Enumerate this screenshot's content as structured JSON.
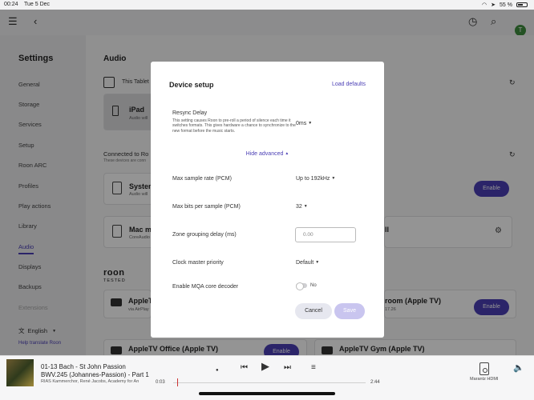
{
  "status": {
    "time": "00:24",
    "date": "Tue 5 Dec",
    "battery": "55 %"
  },
  "sidebar": {
    "title": "Settings",
    "items": [
      {
        "label": "General"
      },
      {
        "label": "Storage"
      },
      {
        "label": "Services"
      },
      {
        "label": "Setup"
      },
      {
        "label": "Roon ARC"
      },
      {
        "label": "Profiles"
      },
      {
        "label": "Play actions"
      },
      {
        "label": "Library"
      },
      {
        "label": "Audio"
      },
      {
        "label": "Displays"
      },
      {
        "label": "Backups"
      },
      {
        "label": "Extensions"
      }
    ],
    "language": "English",
    "help": "Help translate Roon"
  },
  "main": {
    "heading": "Audio",
    "this_tablet": "This Tablet",
    "ipad_name": "iPad",
    "ipad_sub": "Audio will",
    "connected": "Connected to Ro",
    "connected_sub": "These devices are conn",
    "system_name": "System",
    "system_sub": "Audio will",
    "mac_name": "Mac m",
    "mac_sub": "CoreAudio",
    "roon_tested_1": "roon",
    "roon_tested_2": "TESTED",
    "apple1_name": "AppleT",
    "apple1_sub": "via AirPlay",
    "room_name": "room (Apple TV)",
    "room_sub": "17.26",
    "office_name": "AppleTV Office (Apple TV)",
    "gym_name": "AppleTV Gym (Apple TV)",
    "enable": "Enable",
    "mac_right": "ll"
  },
  "modal": {
    "title": "Device setup",
    "load_defaults": "Load defaults",
    "resync_label": "Resync Delay",
    "resync_desc": "This setting causes Roon to pre-roll a period of silence each time it switches formats. This gives hardware a chance to synchronize to the new format before the music starts.",
    "resync_value": "0ms",
    "hide_advanced": "Hide advanced",
    "max_rate_label": "Max sample rate (PCM)",
    "max_rate_value": "Up to 192kHz",
    "max_bits_label": "Max bits per sample (PCM)",
    "max_bits_value": "32",
    "zone_delay_label": "Zone grouping delay (ms)",
    "zone_delay_placeholder": "0.00",
    "clock_label": "Clock master priority",
    "clock_value": "Default",
    "mqa_label": "Enable MQA core decoder",
    "mqa_value": "No",
    "cancel": "Cancel",
    "save": "Save"
  },
  "player": {
    "line1": "01-13 Bach - St John Passion",
    "line2": "BWV.245 (Johannes-Passion) - Part 1",
    "line3": "RIAS Kammerchor, René Jacobs, Academy for An",
    "elapsed": "0:03",
    "duration": "2:44",
    "zone": "Marantz HDMI",
    "progress_fraction": 0.02
  }
}
